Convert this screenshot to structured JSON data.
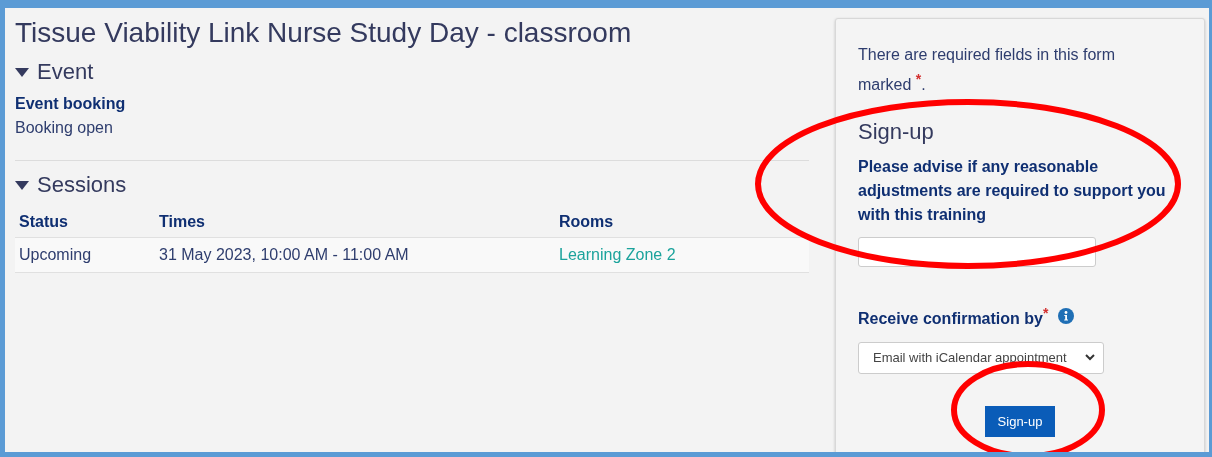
{
  "page": {
    "title": "Tissue Viability Link Nurse Study Day - classroom"
  },
  "event": {
    "heading": "Event",
    "expanded": true,
    "label": "Event booking",
    "value": "Booking open"
  },
  "sessions": {
    "heading": "Sessions",
    "expanded": true,
    "columns": [
      "Status",
      "Times",
      "Rooms"
    ],
    "rows": [
      {
        "status": "Upcoming",
        "times": "31 May 2023, 10:00 AM - 11:00 AM",
        "room": "Learning Zone 2"
      }
    ]
  },
  "form": {
    "required_note": {
      "before": "There are required fields in this form marked",
      "mark": "*",
      "after": "."
    },
    "heading": "Sign-up",
    "fields": [
      {
        "kind": "text",
        "label": "Please advise if any reasonable adjustments are required to support you with this training",
        "required": false
      },
      {
        "kind": "select",
        "label": "Receive confirmation by",
        "required": true,
        "mark": "*",
        "info": true,
        "value": "Email with iCalendar appointment"
      }
    ],
    "submit": "Sign-up"
  },
  "highlights": [
    {
      "kind": "ellipse"
    },
    {
      "kind": "ellipse"
    }
  ]
}
